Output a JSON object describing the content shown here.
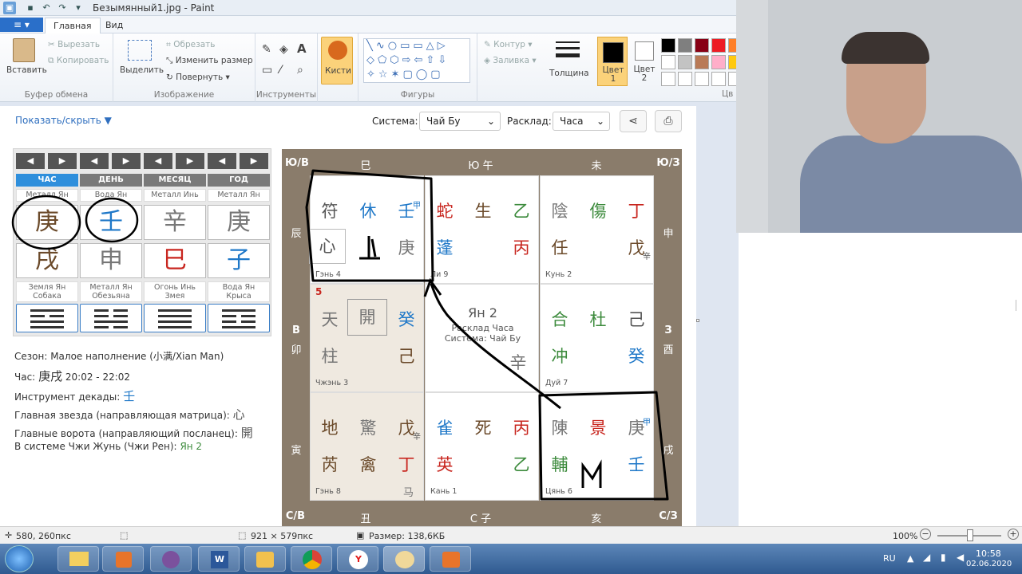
{
  "window": {
    "title": "Безымянный1.jpg - Paint"
  },
  "ribbon_tabs": {
    "main": "Главная",
    "view": "Вид"
  },
  "ribbon": {
    "paste": "Вставить",
    "cut": "Вырезать",
    "copy": "Копировать",
    "clipboard_group": "Буфер обмена",
    "select": "Выделить",
    "crop": "Обрезать",
    "resize": "Изменить размер",
    "rotate": "Повернуть",
    "image_group": "Изображение",
    "tools_group": "Инструменты",
    "brushes": "Кисти",
    "outline": "Контур",
    "fill": "Заливка",
    "shapes_group": "Фигуры",
    "thickness": "Толщина",
    "color1": "Цвет 1",
    "color2": "Цвет 2",
    "colors_group": "Цв"
  },
  "palette": [
    "#000000",
    "#7f7f7f",
    "#880015",
    "#ed1c24",
    "#ff7f27",
    "#ffffff",
    "#c3c3c3",
    "#b97a57",
    "#ffaec9",
    "#ffc90e"
  ],
  "app": {
    "show_hide": "Показать/скрыть",
    "system_label": "Система:",
    "system_value": "Чай Бу",
    "layout_label": "Расклад:",
    "layout_value": "Часа"
  },
  "pillars": {
    "labels": [
      "ЧАС",
      "ДЕНЬ",
      "МЕСЯЦ",
      "ГОД"
    ],
    "stem_elements": [
      "Металл Ян",
      "Вода Ян",
      "Металл Инь",
      "Металл Ян"
    ],
    "stems": [
      "庚",
      "壬",
      "辛",
      "庚"
    ],
    "branches": [
      "戌",
      "申",
      "巳",
      "子"
    ],
    "animals": [
      [
        "Земля Ян",
        "Собака"
      ],
      [
        "Металл Ян",
        "Обезьяна"
      ],
      [
        "Огонь Инь",
        "Змея"
      ],
      [
        "Вода Ян",
        "Крыса"
      ]
    ]
  },
  "info": {
    "season": "Сезон: Малое наполнение (小满/Xian Man)",
    "hour_label": "Час:",
    "hour_chars": "庚戌",
    "hour_time": "20:02 - 22:02",
    "decade_label": "Инструмент декады:",
    "decade_char": "壬",
    "star_label": "Главная звезда (направляющая матрица):",
    "star_char": "心",
    "gate_label": "Главные ворота (направляющий посланец):",
    "gate_char": "開",
    "ren_label": "В системе Чжи Жунь (Чжи Рен):",
    "ren_value": "Ян 2"
  },
  "board": {
    "edges": {
      "nw": "Ю/В",
      "n1": "巳",
      "n2": "Ю 午",
      "n3": "未",
      "ne": "Ю/З",
      "w1": "辰",
      "w2": "В",
      "w2b": "卯",
      "w3": "寅",
      "e1": "申",
      "e2": "З",
      "e2b": "酉",
      "e3": "戌",
      "sw": "С/В",
      "s1": "丑",
      "s2": "С 子",
      "s3": "亥",
      "se": "С/З"
    },
    "palaces": [
      {
        "name": "Гэнь 4",
        "r1": [
          "符",
          "休",
          "壬"
        ],
        "r2": [
          "心",
          "",
          "庚"
        ],
        "sup": "甲"
      },
      {
        "name": "Ли 9",
        "r1": [
          "蛇",
          "生",
          "乙"
        ],
        "r2": [
          "蓬",
          "",
          "丙"
        ]
      },
      {
        "name": "Кунь 2",
        "r1": [
          "陰",
          "傷",
          "丁"
        ],
        "r2": [
          "任",
          "",
          "戊"
        ],
        "sub": "辛"
      },
      {
        "name": "Чжэнь 3",
        "r1": [
          "天",
          "開",
          "癸"
        ],
        "r2": [
          "柱",
          "",
          "己"
        ],
        "num": "5"
      },
      {
        "name": "center",
        "title": "Ян 2",
        "l2": "Расклад Часа",
        "l3": "Система: Чай Бу",
        "ch": "辛"
      },
      {
        "name": "Дуй 7",
        "r1": [
          "合",
          "杜",
          "己"
        ],
        "r2": [
          "冲",
          "",
          "癸"
        ]
      },
      {
        "name": "Гэнь 8",
        "r1": [
          "地",
          "驚",
          "戊"
        ],
        "r2": [
          "芮",
          "禽",
          "丁"
        ],
        "sub": "辛",
        "horse": "马"
      },
      {
        "name": "Кань 1",
        "r1": [
          "雀",
          "死",
          "丙"
        ],
        "r2": [
          "英",
          "",
          "乙"
        ]
      },
      {
        "name": "Цянь 6",
        "r1": [
          "陳",
          "景",
          "庚"
        ],
        "r2": [
          "輔",
          "",
          "壬"
        ],
        "sup": "甲"
      }
    ]
  },
  "statusbar": {
    "pos": "580, 260пкс",
    "size": "921 × 579пкс",
    "filesize": "Размер: 138,6КБ",
    "zoom": "100%"
  },
  "taskbar": {
    "lang": "RU",
    "time": "10:58",
    "date": "02.06.2020"
  }
}
